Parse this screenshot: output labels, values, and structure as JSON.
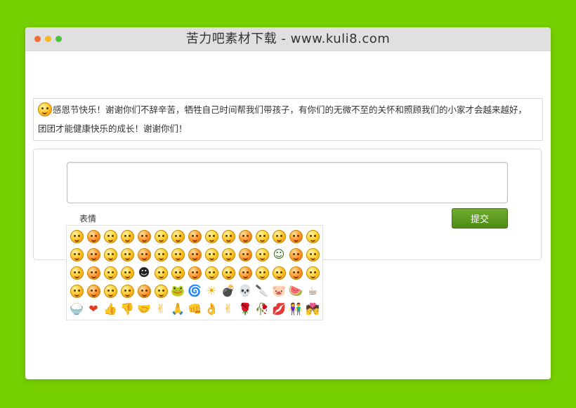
{
  "window": {
    "title": "苦力吧素材下载 - www.kuli8.com",
    "dots": [
      "#f46b3a",
      "#f2bb20",
      "#4cc638"
    ]
  },
  "posted_comment": {
    "icon": "grin-emoji-icon",
    "text": "感恩节快乐！谢谢你们不辞辛苦，牺牲自己时间帮我们带孩子，有你们的无微不至的关怀和照顾我们的小家才会越来越好，团团才能健康快乐的成长！谢谢你们！"
  },
  "form": {
    "comment_value": "",
    "emoji_label": "表情",
    "submit_label": "提交",
    "submit_color": "#5a9a1f"
  },
  "emoji_picker": {
    "rows": 5,
    "columns": 15,
    "items": [
      "smile",
      "shy",
      "heart-eyes",
      "daze",
      "cry",
      "cool",
      "awkward",
      "sleepy",
      "cry-laugh",
      "angry",
      "tongue",
      "grin",
      "surprise",
      "sad",
      "frown",
      "blush",
      "wail",
      "sweat",
      "pout",
      "snicker",
      "tongue-out",
      "doubt",
      "dizzy",
      "sleepy-eyes",
      "rage",
      "smirk",
      "laugh",
      "soldier",
      "struggle",
      "scold",
      "shh",
      "shock",
      "tired",
      "scared",
      "mocking",
      "sweat-wipe",
      "hmm",
      "hug",
      "yawn",
      "evil",
      "chuckle",
      "wave",
      "cheeky",
      "think",
      "rofl",
      "pitiful",
      "groan",
      "wink",
      "kiss",
      "terrified",
      "bye",
      "frog",
      "dizzy-swirl",
      "sun",
      "bomb",
      "skull",
      "knife",
      "pig",
      "watermelon",
      "coffee",
      "rice",
      "heart",
      "thumbs-up",
      "thumbs-down",
      "handshake",
      "victory",
      "salute",
      "fist",
      "ok",
      "peace",
      "rose",
      "wilted-rose",
      "lips",
      "couple",
      "kiss-couple"
    ],
    "special": {
      "heart": "❤",
      "thumbs-up": "👍",
      "thumbs-down": "👎",
      "handshake": "🤝",
      "victory": "✌",
      "peace": "✌",
      "ok": "👌",
      "salute": "🙏",
      "fist": "👊",
      "rose": "🌹",
      "wilted-rose": "🥀",
      "lips": "💋",
      "couple": "👫",
      "kiss-couple": "💏",
      "coffee": "☕",
      "bomb": "💣",
      "skull": "💀",
      "knife": "🔪",
      "pig": "🐷",
      "watermelon": "🍉",
      "sun": "☀",
      "frog": "🐸",
      "dizzy-swirl": "🌀",
      "rice": "🍚",
      "mocking": "☻",
      "soldier": "☺"
    },
    "special_colors": {
      "heart": "#e23c25",
      "thumbs-up": "#f0a21c",
      "thumbs-down": "#f0a21c",
      "handshake": "#f0a21c",
      "victory": "#f0a21c",
      "peace": "#f0a21c",
      "ok": "#f0a21c",
      "salute": "#f0a21c",
      "fist": "#f0a21c",
      "rose": "#d8112c",
      "wilted-rose": "#8a2a1a",
      "lips": "#d81f3c",
      "couple": "#333333",
      "kiss-couple": "#333333",
      "coffee": "#8a5a2b",
      "bomb": "#222222",
      "skull": "#555555",
      "knife": "#666666",
      "pig": "#e48b8b",
      "watermelon": "#2e9e3a",
      "sun": "#f5a800",
      "frog": "#3aa33a",
      "dizzy-swirl": "#2a66d8",
      "rice": "#c87a3a",
      "mocking": "#222222",
      "soldier": "#2f6b1a"
    }
  }
}
